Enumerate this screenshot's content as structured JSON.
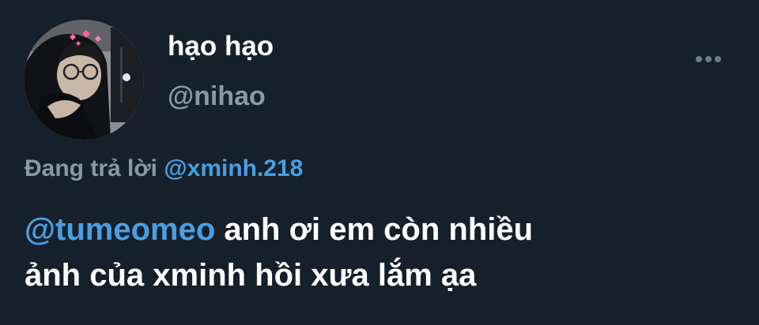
{
  "author": {
    "display_name": "hạo hạo",
    "handle": "@nihao"
  },
  "reply": {
    "prefix": "Đang trả lời",
    "to_handle": "@xminh.218"
  },
  "body": {
    "mention": "@tumeomeo",
    "line1_text": " anh ơi em còn nhiều",
    "line2_text": "ảnh của xminh hồi xưa lắm ạa"
  },
  "icons": {
    "more": "more-horizontal-icon"
  },
  "colors": {
    "background": "#15202b",
    "text": "#ffffff",
    "secondary": "#8b98a5",
    "link": "#4a9fe3"
  }
}
